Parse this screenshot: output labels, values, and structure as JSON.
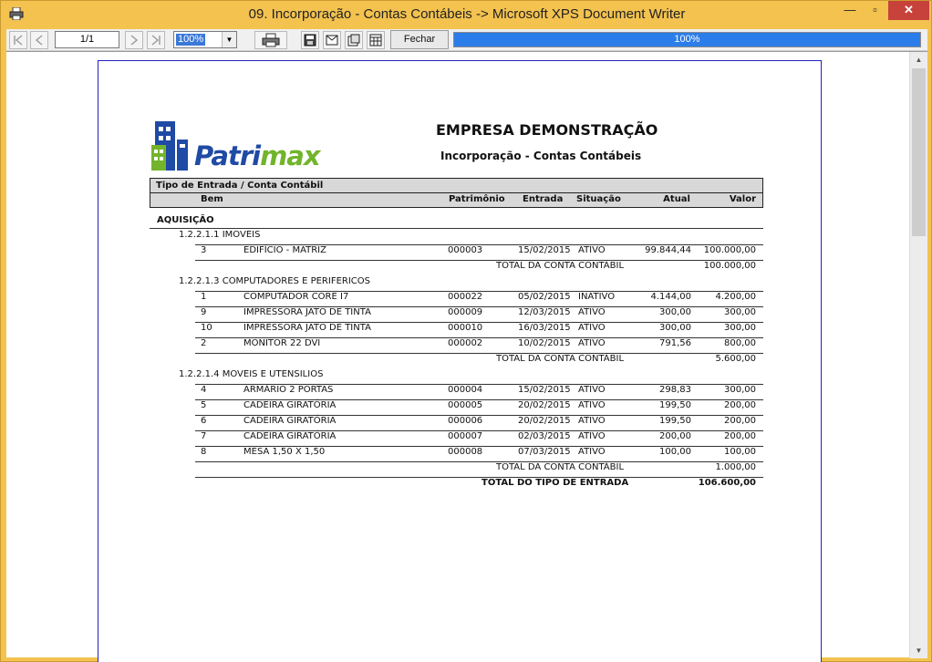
{
  "window": {
    "title": "09. Incorporação - Contas Contábeis -> Microsoft XPS Document Writer",
    "minimize": "—",
    "maximize": "▫",
    "close": "✕"
  },
  "toolbar": {
    "page_value": "1/1",
    "zoom_value": "100%",
    "close_label": "Fechar",
    "progress_text": "100%",
    "progress_value": 1.0
  },
  "report": {
    "logo": {
      "part1": "Patri",
      "part2": "max"
    },
    "company": "EMPRESA DEMONSTRAÇÃO",
    "subtitle": "Incorporação - Contas Contábeis",
    "header_row1": "Tipo de Entrada / Conta Contábil",
    "columns": {
      "bem": "Bem",
      "patrimonio": "Patrimônio",
      "entrada": "Entrada",
      "situacao": "Situação",
      "atual": "Atual",
      "valor": "Valor"
    },
    "entry_type": "AQUISIÇÃO",
    "accounts": [
      {
        "name": "1.2.2.1.1 IMOVEIS",
        "items": [
          {
            "num": "3",
            "desc": "EDIFÍCIO - MATRIZ",
            "patrimonio": "000003",
            "entrada": "15/02/2015",
            "situacao": "ATIVO",
            "atual": "99.844,44",
            "valor": "100.000,00"
          }
        ],
        "total_label": "TOTAL DA CONTA CONTÁBIL",
        "total": "100.000,00"
      },
      {
        "name": "1.2.2.1.3 COMPUTADORES E PERIFERICOS",
        "items": [
          {
            "num": "1",
            "desc": "COMPUTADOR CORE I7",
            "patrimonio": "000022",
            "entrada": "05/02/2015",
            "situacao": "INATIVO",
            "atual": "4.144,00",
            "valor": "4.200,00"
          },
          {
            "num": "9",
            "desc": "IMPRESSORA JATO DE TINTA",
            "patrimonio": "000009",
            "entrada": "12/03/2015",
            "situacao": "ATIVO",
            "atual": "300,00",
            "valor": "300,00"
          },
          {
            "num": "10",
            "desc": "IMPRESSORA JATO DE TINTA",
            "patrimonio": "000010",
            "entrada": "16/03/2015",
            "situacao": "ATIVO",
            "atual": "300,00",
            "valor": "300,00"
          },
          {
            "num": "2",
            "desc": "MONITOR 22 DVI",
            "patrimonio": "000002",
            "entrada": "10/02/2015",
            "situacao": "ATIVO",
            "atual": "791,56",
            "valor": "800,00"
          }
        ],
        "total_label": "TOTAL DA CONTA CONTÁBIL",
        "total": "5.600,00"
      },
      {
        "name": "1.2.2.1.4 MOVEIS E UTENSILIOS",
        "items": [
          {
            "num": "4",
            "desc": "ARMÁRIO 2 PORTAS",
            "patrimonio": "000004",
            "entrada": "15/02/2015",
            "situacao": "ATIVO",
            "atual": "298,83",
            "valor": "300,00"
          },
          {
            "num": "5",
            "desc": "CADEIRA GIRATÓRIA",
            "patrimonio": "000005",
            "entrada": "20/02/2015",
            "situacao": "ATIVO",
            "atual": "199,50",
            "valor": "200,00"
          },
          {
            "num": "6",
            "desc": "CADEIRA GIRATÓRIA",
            "patrimonio": "000006",
            "entrada": "20/02/2015",
            "situacao": "ATIVO",
            "atual": "199,50",
            "valor": "200,00"
          },
          {
            "num": "7",
            "desc": "CADEIRA GIRATÓRIA",
            "patrimonio": "000007",
            "entrada": "02/03/2015",
            "situacao": "ATIVO",
            "atual": "200,00",
            "valor": "200,00"
          },
          {
            "num": "8",
            "desc": "MESA 1,50 X 1,50",
            "patrimonio": "000008",
            "entrada": "07/03/2015",
            "situacao": "ATIVO",
            "atual": "100,00",
            "valor": "100,00"
          }
        ],
        "total_label": "TOTAL DA CONTA CONTÁBIL",
        "total": "1.000,00"
      }
    ],
    "grand_total_label": "TOTAL DO TIPO DE ENTRADA",
    "grand_total": "106.600,00"
  },
  "colors": {
    "titlebar": "#f3c24f",
    "close_button": "#c7423a",
    "progress": "#2b7de9",
    "logo_blue": "#1f4aa5",
    "logo_green": "#72b42c",
    "page_border": "#2020c0"
  }
}
